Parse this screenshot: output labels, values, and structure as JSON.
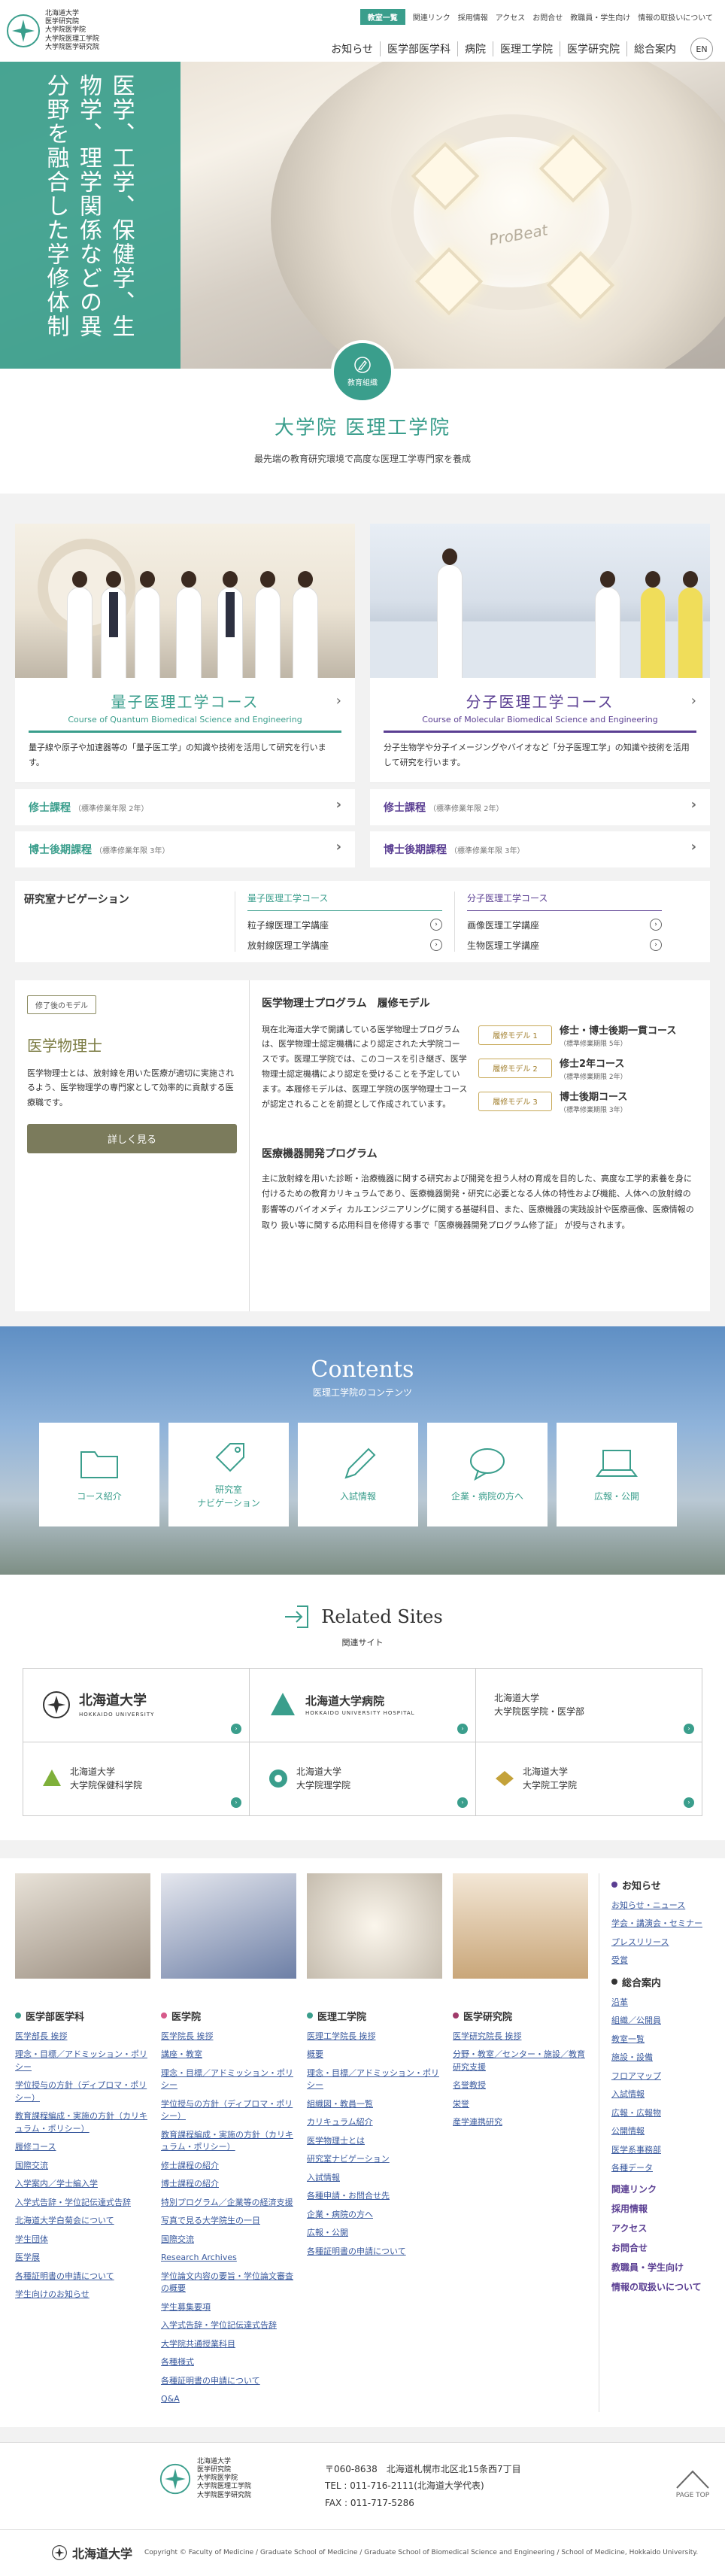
{
  "header": {
    "logo_lines": [
      "北海道大学",
      "医学研究院",
      "大学院医学院",
      "大学院医理工学院",
      "大学院医学研究院"
    ],
    "top_links": [
      "教室一覧",
      "関連リンク",
      "採用情報",
      "アクセス",
      "お問合せ",
      "教職員・学生向け",
      "情報の取扱いについて"
    ],
    "main_nav": [
      "お知らせ",
      "医学部医学科",
      "病院",
      "医理工学院",
      "医学研究院",
      "総合案内"
    ],
    "lang": "EN"
  },
  "hero": {
    "copy": "医学、工学、保健学、生物学、理学関係などの異分野を融合した学修体制",
    "brand": "ProBeat"
  },
  "intro": {
    "badge": "教育組織",
    "title": "大学院 医理工学院",
    "subtitle": "最先端の教育研究環境で高度な医理工学専門家を養成"
  },
  "courses": [
    {
      "title": "量子医理工学コース",
      "en": "Course of Quantum Biomedical Science and Engineering",
      "desc": "量子線や原子や加速器等の「量子医工学」の知識や技術を活用して研究を行います。",
      "programs": [
        {
          "label": "修士課程",
          "note": "（標準修業年限 2年）"
        },
        {
          "label": "博士後期課程",
          "note": "（標準修業年限 3年）"
        }
      ]
    },
    {
      "title": "分子医理工学コース",
      "en": "Course of Molecular Biomedical Science and Engineering",
      "desc": "分子生物学や分子イメージングやバイオなど「分子医理工学」の知識や技術を活用して研究を行います。",
      "programs": [
        {
          "label": "修士課程",
          "note": "（標準修業年限 2年）"
        },
        {
          "label": "博士後期課程",
          "note": "（標準修業年限 3年）"
        }
      ]
    }
  ],
  "labnav": {
    "title": "研究室ナビゲーション",
    "cols": [
      {
        "head": "量子医理工学コース",
        "items": [
          "粒子線医理工学講座",
          "放射線医理工学講座"
        ]
      },
      {
        "head": "分子医理工学コース",
        "items": [
          "画像医理工学講座",
          "生物医理工学講座"
        ]
      }
    ]
  },
  "mp": {
    "tag": "修了後のモデル",
    "title": "医学物理士",
    "text": "医学物理士とは、放射線を用いた医療が適切に実施されるよう、医学物理学の専門家として効率的に貢献する医療職です。",
    "button": "詳しく見る",
    "prog_title": "医学物理士プログラム　履修モデル",
    "prog_text": "現在北海道大学で開講している医学物理士プログラムは、医学物理士認定機構により認定された大学院コースです。医理工学院では、このコースを引き継ぎ、医学物理士認定機構により認定を受けることを予定しています。本履修モデルは、医理工学院の医学物理士コースが認定されることを前提として作成されています。",
    "models": [
      {
        "label": "履修モデル 1",
        "name": "修士・博士後期一貫コース",
        "note": "（標準修業期限 5年）"
      },
      {
        "label": "履修モデル 2",
        "name": "修士2年コース",
        "note": "（標準修業期限 2年）"
      },
      {
        "label": "履修モデル 3",
        "name": "博士後期コース",
        "note": "（標準修業期限 3年）"
      }
    ],
    "dev_title": "医療機器開発プログラム",
    "dev_text": "主に放射線を用いた診断・治療機器に関する研究および開発を担う人材の育成を目的した、高度な工学的素養を身に付けるための教育カリキュラムであり、医療機器開発・研究に必要となる人体の特性および機能、人体への放射線の影響等のバイオメディ カルエンジニアリングに関する基礎科目、また、医療機器の実践設計や医療画像、医療情報の取り 扱い等に関する応用科目を修得する事で「医療機器開発プログラム修了証」 が授与されます。"
  },
  "contents": {
    "title": "Contents",
    "sub": "医理工学院のコンテンツ",
    "tiles": [
      "コース紹介",
      "研究室\nナビゲーション",
      "入試情報",
      "企業・病院の方へ",
      "広報・公開"
    ]
  },
  "related": {
    "title": "Related Sites",
    "sub": "関連サイト",
    "sites": [
      {
        "name": "北海道大学",
        "sub": "HOKKAIDO UNIVERSITY"
      },
      {
        "name": "北海道大学病院",
        "sub": "HOKKAIDO UNIVERSITY HOSPITAL"
      },
      {
        "name": "北海道大学\n大学院医学院・医学部",
        "sub": ""
      },
      {
        "name": "北海道大学\n大学院保健科学院",
        "sub": ""
      },
      {
        "name": "北海道大学\n大学院理学院",
        "sub": ""
      },
      {
        "name": "北海道大学\n大学院工学院",
        "sub": ""
      }
    ]
  },
  "sitemap": {
    "cols": [
      {
        "head": "医学部医学科",
        "items": [
          "医学部長 挨拶",
          "理念・目標／アドミッション・ポリシー",
          "学位授与の方針（ディプロマ・ポリシー）",
          "教育課程編成・実施の方針（カリキュラム・ポリシー）",
          "履修コース",
          "国際交流",
          "入学案内／学士編入学",
          "入学式告辞・学位記伝達式告辞",
          "北海道大学白菊会について",
          "学生団体",
          "医学展",
          "各種証明書の申請について",
          "学生向けのお知らせ"
        ]
      },
      {
        "head": "医学院",
        "items": [
          "医学院長 挨拶",
          "講座・教室",
          "理念・目標／アドミッション・ポリシー",
          "学位授与の方針（ディプロマ・ポリシー）",
          "教育課程編成・実施の方針（カリキュラム・ポリシー）",
          "修士課程の紹介",
          "博士課程の紹介",
          "特別プログラム／企業等の経済支援",
          "写真で見る大学院生の一日",
          "国際交流",
          "Research Archives",
          "学位論文内容の要旨・学位論文審査の概要",
          "学生募集要項",
          "入学式告辞・学位記伝達式告辞",
          "大学院共通授業科目",
          "各種様式",
          "各種証明書の申請について",
          "Q&A"
        ]
      },
      {
        "head": "医理工学院",
        "items": [
          "医理工学院長 挨拶",
          "概要",
          "理念・目標／アドミッション・ポリシー",
          "組織図・教員一覧",
          "カリキュラム紹介",
          "医学物理士とは",
          "研究室ナビゲーション",
          "入試情報",
          "各種申請・お問合せ先",
          "企業・病院の方へ",
          "広報・公開",
          "各種証明書の申請について"
        ]
      },
      {
        "head": "医学研究院",
        "items": [
          "医学研究院長 挨拶",
          "分野・教室／センター・施設／教育研究支援",
          "名誉教授",
          "栄誉",
          "産学連携研究"
        ]
      }
    ],
    "right": {
      "news_head": "お知らせ",
      "news": [
        "お知らせ・ニュース",
        "学会・講演会・セミナー",
        "プレスリリース",
        "受賞"
      ],
      "general_head": "総合案内",
      "general": [
        "沿革",
        "組織／公開員",
        "教室一覧",
        "施設・設備",
        "フロアマップ",
        "入試情報",
        "広報・広報物",
        "公開情報",
        "医学系事務部",
        "各種データ"
      ],
      "links": [
        "関連リンク",
        "採用情報",
        "アクセス",
        "お問合せ",
        "教職員・学生向け",
        "情報の取扱いについて"
      ]
    }
  },
  "footer": {
    "logo_lines": [
      "北海道大学",
      "医学研究院",
      "大学院医学院",
      "大学院医理工学院",
      "大学院医学研究院"
    ],
    "address": "〒060-8638　北海道札幌市北区北15条西7丁目",
    "tel": "TEL : 011-716-2111(北海道大学代表)",
    "fax": "FAX : 011-717-5286",
    "pagetop": "PAGE TOP",
    "univ": "北海道大学",
    "copyright": "Copyright © Faculty of Medicine / Graduate School of Medicine / Graduate School of Biomedical Science and Engineering / School of Medicine, Hokkaido University."
  },
  "colors": {
    "teal": "#3a9e8c",
    "purple": "#5a3e92",
    "olive": "#7b7b42"
  },
  "icons": [
    "pen-icon",
    "folder-icon",
    "tag-icon",
    "pencil-icon",
    "speech-bubble-icon",
    "laptop-icon",
    "exit-arrow-icon"
  ]
}
